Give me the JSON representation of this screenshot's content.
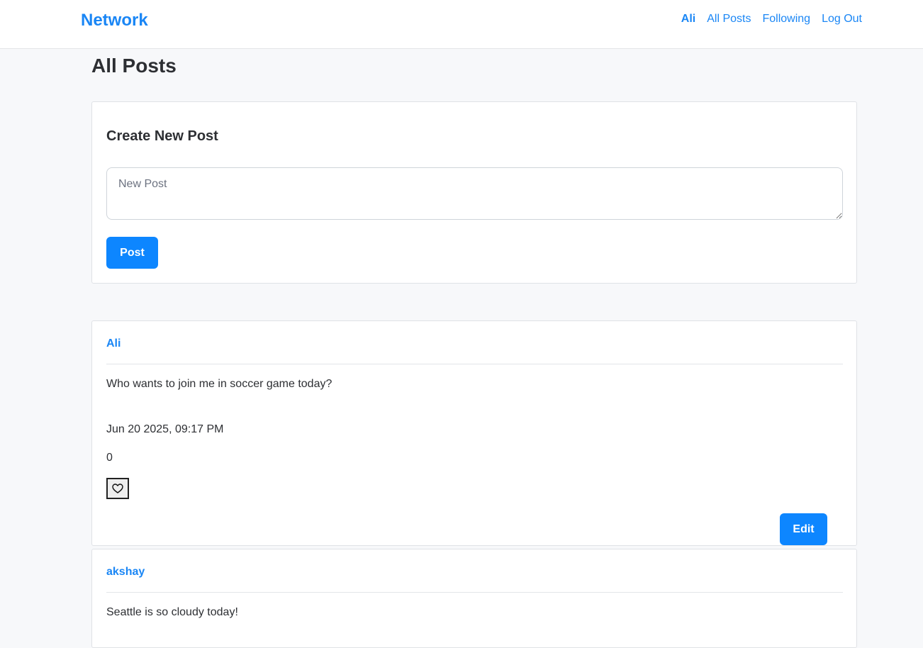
{
  "navbar": {
    "brand": "Network",
    "links": [
      {
        "label": "Ali"
      },
      {
        "label": "All Posts"
      },
      {
        "label": "Following"
      },
      {
        "label": "Log Out"
      }
    ]
  },
  "page_title": "All Posts",
  "create_post": {
    "title": "Create New Post",
    "placeholder": "New Post",
    "value": "",
    "button_label": "Post"
  },
  "posts": [
    {
      "author": "Ali",
      "content": "Who wants to join me in soccer game today?",
      "timestamp": "Jun 20 2025, 09:17 PM",
      "likes": "0",
      "like_icon": "heart-outline-icon",
      "edit_label": "Edit"
    },
    {
      "author": "akshay",
      "content": "Seattle is so cloudy today!"
    }
  ],
  "colors": {
    "accent": "#1a86f5",
    "button": "#0d86ff",
    "background": "#f7f8fa"
  }
}
